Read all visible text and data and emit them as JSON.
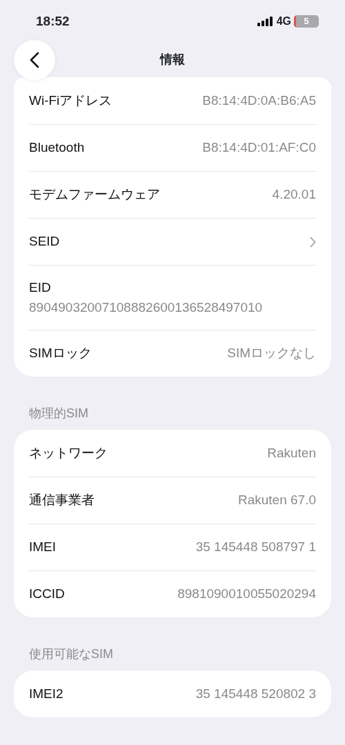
{
  "status_bar": {
    "time": "18:52",
    "network": "4G",
    "battery": "5"
  },
  "header": {
    "title": "情報"
  },
  "sections": [
    {
      "rows": [
        {
          "kind": "value",
          "label": "Wi-Fiアドレス",
          "value": "B8:14:4D:0A:B6:A5"
        },
        {
          "kind": "value",
          "label": "Bluetooth",
          "value": "B8:14:4D:01:AF:C0"
        },
        {
          "kind": "value",
          "label": "モデムファームウェア",
          "value": "4.20.01"
        },
        {
          "kind": "chevron",
          "label": "SEID"
        },
        {
          "kind": "stacked",
          "label": "EID",
          "value": "89049032007108882600136528497010"
        },
        {
          "kind": "value",
          "label": "SIMロック",
          "value": "SIMロックなし"
        }
      ]
    },
    {
      "heading": "物理的SIM",
      "rows": [
        {
          "kind": "value",
          "label": "ネットワーク",
          "value": "Rakuten"
        },
        {
          "kind": "value",
          "label": "通信事業者",
          "value": "Rakuten 67.0"
        },
        {
          "kind": "value",
          "label": "IMEI",
          "value": "35 145448 508797 1"
        },
        {
          "kind": "value",
          "label": "ICCID",
          "value": "8981090010055020294"
        }
      ]
    },
    {
      "heading": "使用可能なSIM",
      "rows": [
        {
          "kind": "value",
          "label": "IMEI2",
          "value": "35 145448 520802 3"
        }
      ]
    }
  ]
}
